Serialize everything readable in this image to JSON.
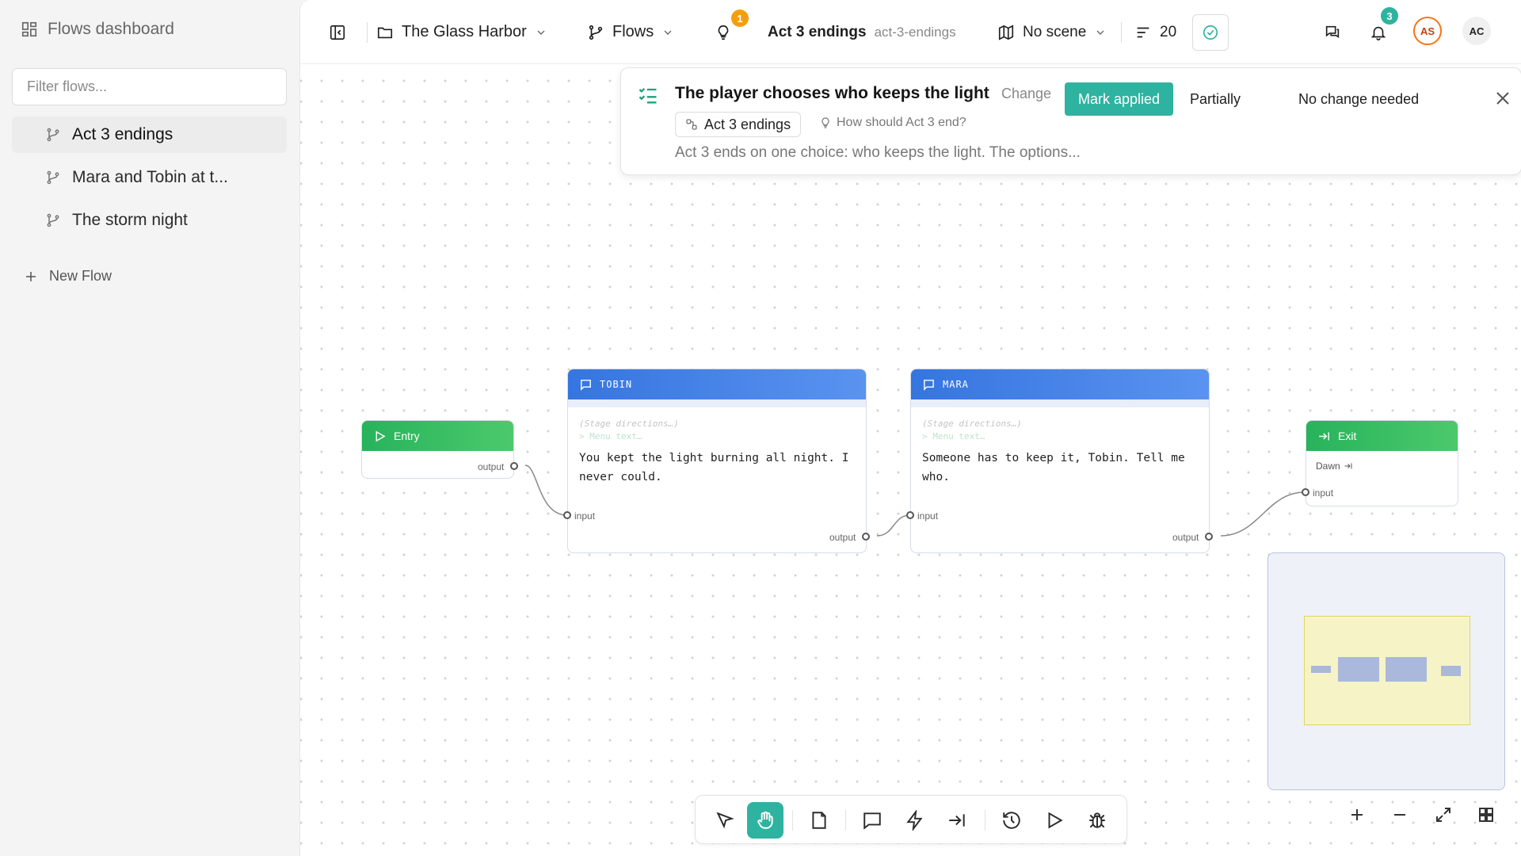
{
  "sidebar": {
    "title": "Flows dashboard",
    "filter_placeholder": "Filter flows...",
    "items": [
      {
        "label": "Act 3 endings",
        "active": true
      },
      {
        "label": "Mara and Tobin at t..."
      },
      {
        "label": "The storm night"
      }
    ],
    "new_flow_label": "New Flow"
  },
  "topbar": {
    "project": "The Glass Harbor",
    "section": "Flows",
    "ideas_badge": "1",
    "flow_name": "Act 3 endings",
    "flow_slug": "act-3-endings",
    "scene": "No scene",
    "line_count": "20",
    "notifications_badge": "3",
    "avatars": [
      "AS",
      "AC"
    ]
  },
  "review": {
    "title": "The player chooses who keeps the light",
    "kind": "Change",
    "flow_chip": "Act 3 endings",
    "question": "How should Act 3 end?",
    "description": "Act 3 ends on one choice: who keeps the light. The options...",
    "apply_label": "Mark applied",
    "partial_label": "Partially",
    "no_change_label": "No change needed"
  },
  "nodes": {
    "entry": {
      "label": "Entry",
      "output": "output"
    },
    "tobin": {
      "speaker": "TOBIN",
      "stage_placeholder": "(Stage directions…)",
      "menu_placeholder": "> Menu text…",
      "text": "You kept the light burning all night. I never could.",
      "input": "input",
      "output": "output"
    },
    "mara": {
      "speaker": "MARA",
      "stage_placeholder": "(Stage directions…)",
      "menu_placeholder": "> Menu text…",
      "text": "Someone has to keep it, Tobin. Tell me who.",
      "input": "input",
      "output": "output"
    },
    "exit": {
      "label": "Exit",
      "target": "Dawn",
      "input": "input"
    }
  },
  "toolbar": {
    "tools": [
      "select-tool",
      "pan-tool",
      "note-tool",
      "dialogue-tool",
      "event-tool",
      "exit-tool",
      "history-tool",
      "play-tool",
      "debug-tool"
    ],
    "active": "pan-tool"
  },
  "colors": {
    "accent": "#2eb3a0",
    "entry_green": "#27b35b",
    "dialogue_blue": "#3575e0",
    "ideas_badge": "#f59e0b",
    "notif_badge": "#2eb3a0",
    "avatar_as": "#f97316"
  }
}
